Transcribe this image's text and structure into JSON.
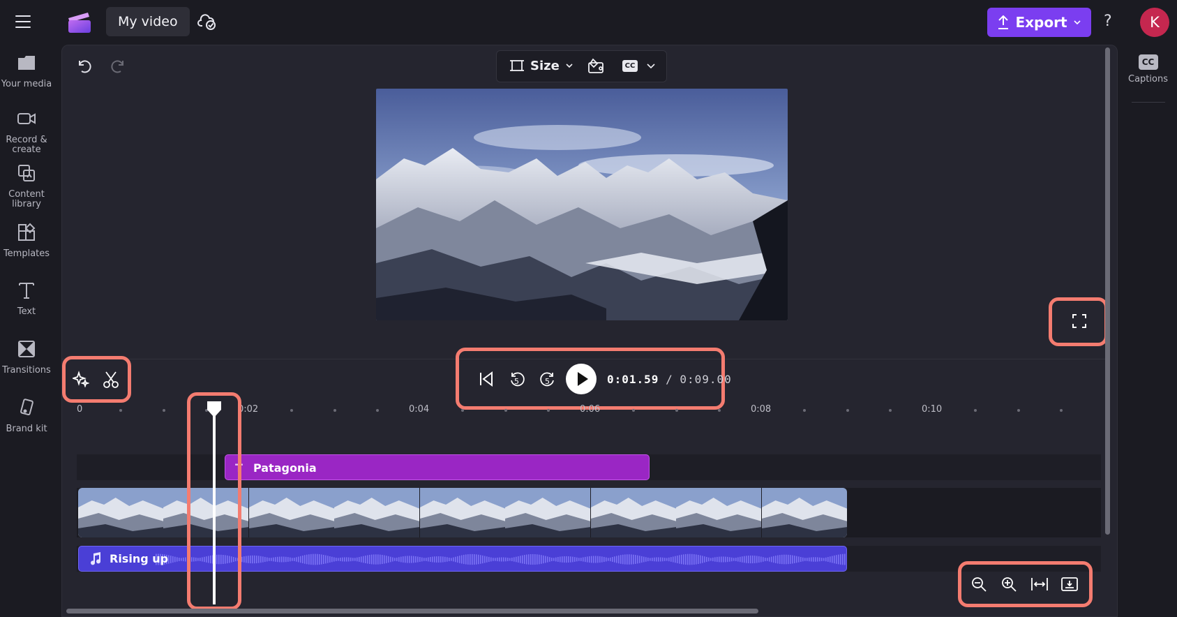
{
  "app": {
    "project_title": "My video",
    "export_label": "Export",
    "avatar_initial": "K",
    "accent_color": "#7b3ef0"
  },
  "leftnav": {
    "items": [
      {
        "label": "Your media",
        "icon": "folder-icon"
      },
      {
        "label": "Record & create",
        "icon": "camera-icon"
      },
      {
        "label": "Content library",
        "icon": "content-library-icon"
      },
      {
        "label": "Templates",
        "icon": "templates-icon"
      },
      {
        "label": "Text",
        "icon": "text-icon"
      },
      {
        "label": "Transitions",
        "icon": "transitions-icon"
      },
      {
        "label": "Brand kit",
        "icon": "brand-kit-icon"
      }
    ]
  },
  "rightpanel": {
    "captions_label": "Captions",
    "captions_icon_text": "CC"
  },
  "preview": {
    "size_label": "Size",
    "cc_icon_text": "CC"
  },
  "playback": {
    "back_seconds": "5",
    "forward_seconds": "5",
    "current_time": "0:01.59",
    "separator": "/",
    "total_time": "0:09.00"
  },
  "timeline": {
    "ruler_labels": [
      "0",
      "0:02",
      "0:04",
      "0:06",
      "0:08",
      "0:10"
    ],
    "title_clip_label": "Patagonia",
    "title_clip_icon_text": "T",
    "audio_clip_label": "Rising up",
    "playhead_position_seconds": 1.59,
    "video_thumbnail_count": 9
  },
  "highlight_color": "#f47c70"
}
